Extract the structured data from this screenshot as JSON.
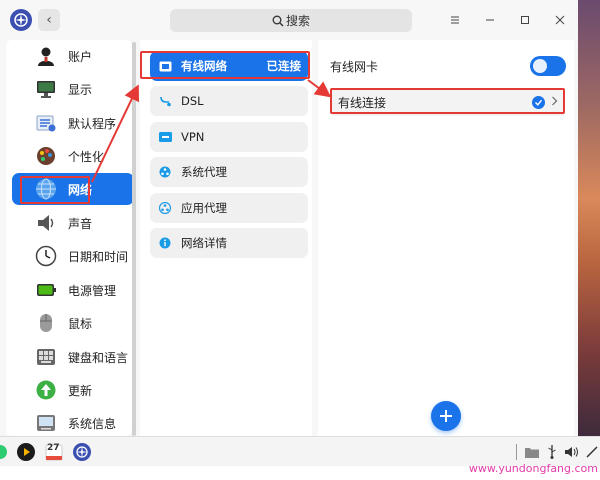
{
  "search": {
    "label": "搜索"
  },
  "sidebar": {
    "items": [
      {
        "label": "账户",
        "icon": "account-icon"
      },
      {
        "label": "显示",
        "icon": "display-icon"
      },
      {
        "label": "默认程序",
        "icon": "default-apps-icon"
      },
      {
        "label": "个性化",
        "icon": "personalization-icon"
      },
      {
        "label": "网络",
        "icon": "network-icon",
        "active": true
      },
      {
        "label": "声音",
        "icon": "sound-icon"
      },
      {
        "label": "日期和时间",
        "icon": "clock-icon"
      },
      {
        "label": "电源管理",
        "icon": "battery-icon"
      },
      {
        "label": "鼠标",
        "icon": "mouse-icon"
      },
      {
        "label": "键盘和语言",
        "icon": "keyboard-icon"
      },
      {
        "label": "更新",
        "icon": "update-icon"
      },
      {
        "label": "系统信息",
        "icon": "system-info-icon"
      }
    ]
  },
  "network_menu": {
    "items": [
      {
        "label": "有线网络",
        "status": "已连接",
        "icon": "wired-icon",
        "active": true
      },
      {
        "label": "DSL",
        "icon": "dsl-icon"
      },
      {
        "label": "VPN",
        "icon": "vpn-icon"
      },
      {
        "label": "系统代理",
        "icon": "system-proxy-icon"
      },
      {
        "label": "应用代理",
        "icon": "app-proxy-icon"
      },
      {
        "label": "网络详情",
        "icon": "info-icon"
      }
    ]
  },
  "wired": {
    "card_label": "有线网卡",
    "card_enabled": true,
    "connection_label": "有线连接",
    "connection_active": true
  },
  "taskbar": {
    "date_badge": "27"
  },
  "watermark": "www.yundongfang.com",
  "colors": {
    "accent": "#1a73e8",
    "annotation": "#e53935"
  }
}
